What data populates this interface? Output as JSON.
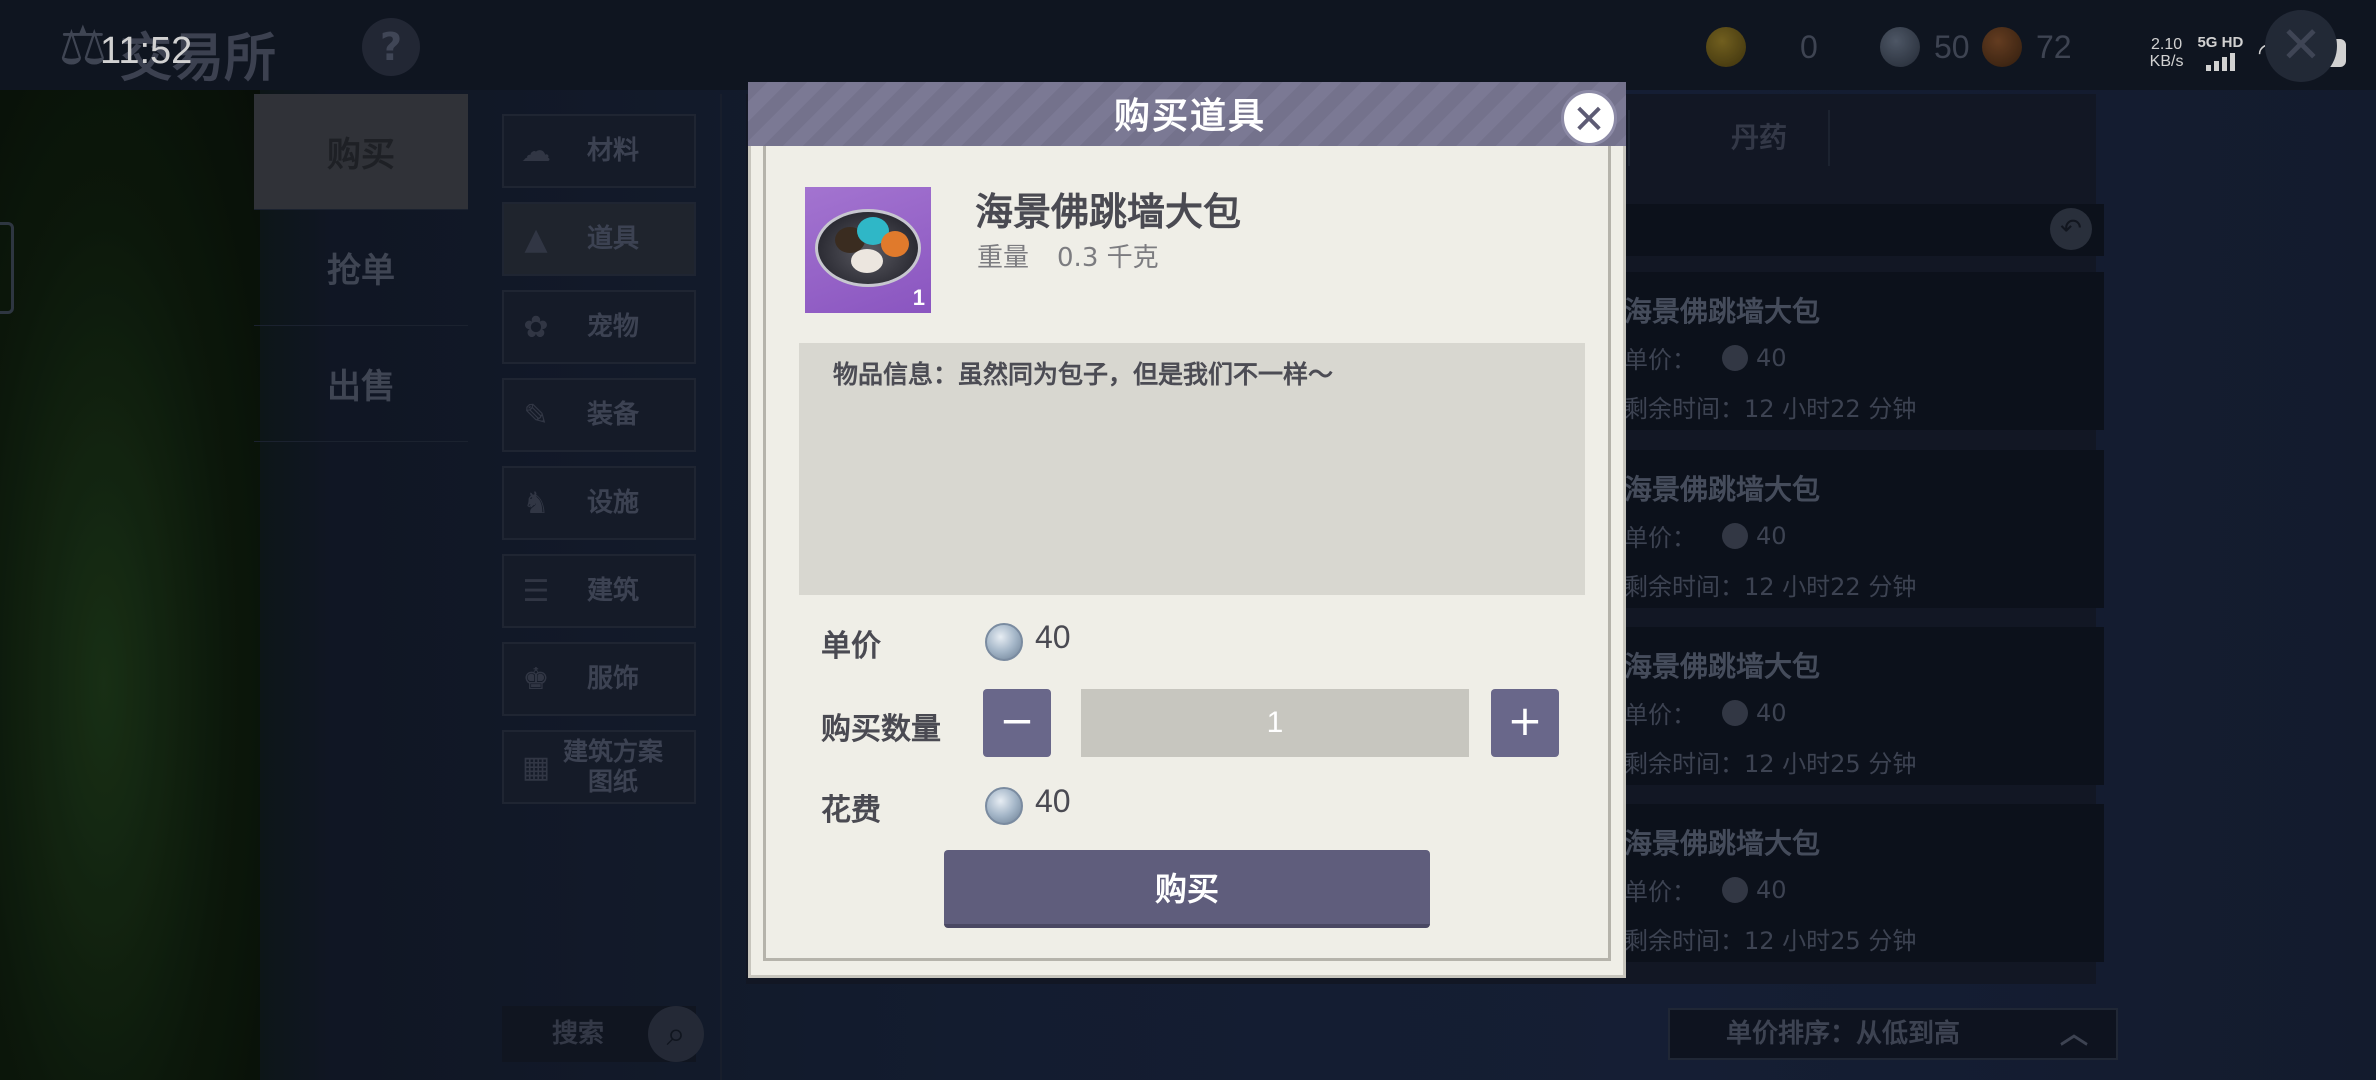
{
  "status_bar": {
    "time": "11:52",
    "net_speed_value": "2.10",
    "net_speed_unit": "KB/s",
    "network": "5G HD",
    "battery": "76"
  },
  "header": {
    "title": "交易所",
    "help_label": "?",
    "currencies": [
      {
        "icon": "gold-coin-icon",
        "value": "0"
      },
      {
        "icon": "silver-coin-icon",
        "value": "50"
      },
      {
        "icon": "bronze-coin-icon",
        "value": "72"
      }
    ]
  },
  "left_nav": {
    "tabs": [
      {
        "label": "购买",
        "active": true
      },
      {
        "label": "抢单",
        "active": false
      },
      {
        "label": "出售",
        "active": false
      }
    ]
  },
  "categories": [
    {
      "label": "材料",
      "icon": "material-icon"
    },
    {
      "label": "道具",
      "icon": "item-icon",
      "active": true
    },
    {
      "label": "宠物",
      "icon": "paw-icon"
    },
    {
      "label": "装备",
      "icon": "equipment-icon"
    },
    {
      "label": "设施",
      "icon": "facility-icon"
    },
    {
      "label": "建筑",
      "icon": "building-icon"
    },
    {
      "label": "服饰",
      "icon": "clothing-icon"
    },
    {
      "label": "建筑方案图纸",
      "icon": "blueprint-icon"
    }
  ],
  "search": {
    "placeholder": "搜索"
  },
  "top_tabs": {
    "visible_tab": "丹药"
  },
  "listings": [
    {
      "name": "海景佛跳墙大包",
      "price_label": "单价：",
      "price": "40",
      "time": "剩余时间：12 小时22 分钟"
    },
    {
      "name": "海景佛跳墙大包",
      "price_label": "单价：",
      "price": "40",
      "time": "剩余时间：12 小时22 分钟"
    },
    {
      "name": "海景佛跳墙大包",
      "price_label": "单价：",
      "price": "40",
      "time": "剩余时间：12 小时25 分钟"
    },
    {
      "name": "海景佛跳墙大包",
      "price_label": "单价：",
      "price": "40",
      "time": "剩余时间：12 小时25 分钟"
    }
  ],
  "sort": {
    "label": "单价排序：从低到高"
  },
  "modal": {
    "title": "购买道具",
    "item_name": "海景佛跳墙大包",
    "item_count": "1",
    "weight_label": "重量",
    "weight_value": "0.3 千克",
    "description": "物品信息：虽然同为包子，但是我们不一样～",
    "unit_price_label": "单价",
    "unit_price": "40",
    "quantity_label": "购买数量",
    "quantity": "1",
    "minus_label": "−",
    "plus_label": "+",
    "cost_label": "花费",
    "cost": "40",
    "buy_label": "购买"
  }
}
